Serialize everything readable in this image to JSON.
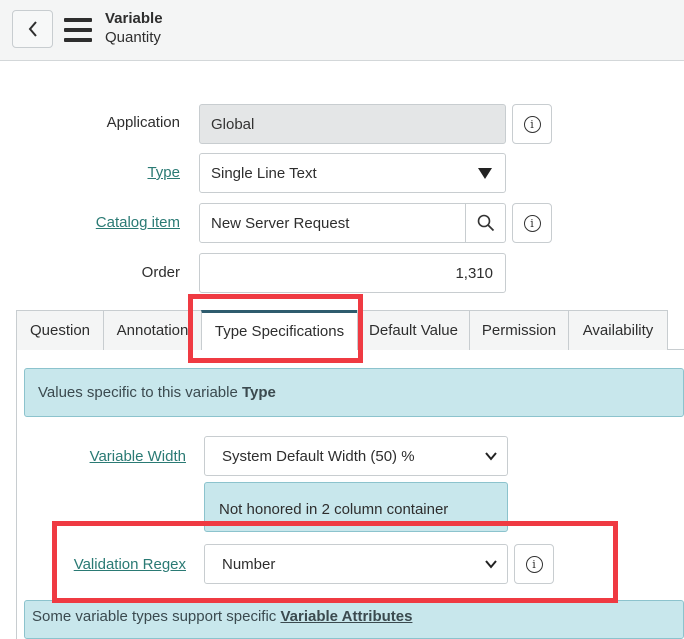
{
  "header": {
    "title": "Variable",
    "subtitle": "Quantity"
  },
  "form": {
    "application": {
      "label": "Application",
      "value": "Global"
    },
    "type": {
      "label": "Type",
      "value": "Single Line Text"
    },
    "catalog_item": {
      "label": "Catalog item",
      "value": "New Server Request"
    },
    "order": {
      "label": "Order",
      "value": "1,310"
    }
  },
  "tabs": [
    {
      "label": "Question"
    },
    {
      "label": "Annotation"
    },
    {
      "label": "Type Specifications"
    },
    {
      "label": "Default Value"
    },
    {
      "label": "Permission"
    },
    {
      "label": "Availability"
    }
  ],
  "type_specs": {
    "info_text": "Values specific to this variable",
    "info_bold": "Type",
    "variable_width": {
      "label": "Variable Width",
      "value": "System Default Width (50) %"
    },
    "note": "Not honored in 2 column container",
    "validation_regex": {
      "label": "Validation Regex",
      "value": "Number"
    },
    "footer_text": "Some variable types support specific",
    "footer_link": "Variable Attributes"
  },
  "colors": {
    "accent": "#2a7a74",
    "highlight": "#ef3a42",
    "info_bg": "#c8e7ec"
  }
}
